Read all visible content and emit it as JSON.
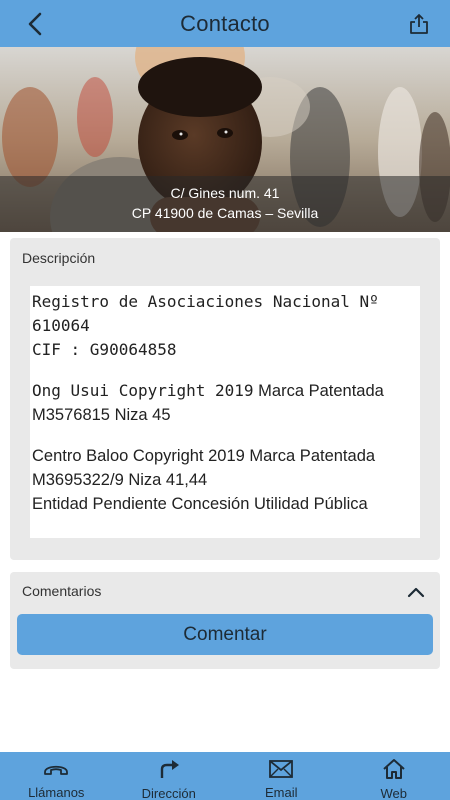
{
  "header": {
    "title": "Contacto",
    "back_icon": "chevron-left-icon",
    "share_icon": "share-icon"
  },
  "hero": {
    "address_line1": "C/ Gines num. 41",
    "address_line2": "CP 41900 de Camas – Sevilla"
  },
  "description": {
    "label": "Descripción",
    "p1_line1": "Registro de Asociaciones Nacional Nº",
    "p1_line2": "610064",
    "p1_line3": "CIF : G90064858",
    "p2_mono": "Ong Usui Copyright 2019",
    "p2_rest": " Marca Patentada",
    "p2_line2": "M3576815 Niza 45",
    "p3_line1": "Centro Baloo Copyright 2019 Marca Patentada",
    "p3_line2": "M3695322/9 Niza 41,44",
    "p3_line3": "Entidad Pendiente Concesión Utilidad Pública"
  },
  "comments": {
    "label": "Comentarios",
    "button_label": "Comentar",
    "toggle_icon": "chevron-up-icon"
  },
  "tabbar": {
    "items": [
      {
        "label": "Llámanos",
        "icon": "phone-icon"
      },
      {
        "label": "Dirección",
        "icon": "direction-arrow-icon"
      },
      {
        "label": "Email",
        "icon": "envelope-icon"
      },
      {
        "label": "Web",
        "icon": "home-icon"
      }
    ]
  },
  "colors": {
    "accent": "#5ea3dd",
    "card_bg": "#e9e9e9",
    "text_dark": "#1d2b36"
  }
}
